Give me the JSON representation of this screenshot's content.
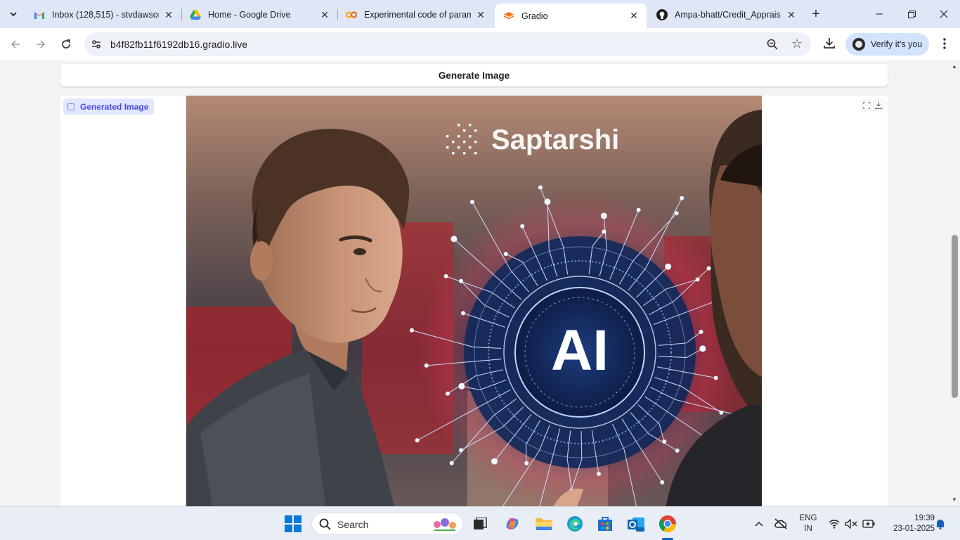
{
  "tabs": [
    {
      "title": "Inbox (128,515) - stvdawson",
      "icon": "gmail-icon"
    },
    {
      "title": "Home - Google Drive",
      "icon": "google-drive-icon"
    },
    {
      "title": "Experimental code of param",
      "icon": "colab-icon"
    },
    {
      "title": "Gradio",
      "icon": "gradio-icon",
      "active": true
    },
    {
      "title": "Ampa-bhatt/Credit_Apprais",
      "icon": "github-icon"
    }
  ],
  "address_bar": {
    "url": "b4f82fb11f6192db16.gradio.live"
  },
  "profile": {
    "label": "Verify it's you"
  },
  "page": {
    "generate_button": "Generate Image",
    "output_label": "Generated Image",
    "image_overlay": {
      "brand": "Saptarshi",
      "center_text": "AI"
    }
  },
  "taskbar": {
    "search_placeholder": "Search",
    "language_line1": "ENG",
    "language_line2": "IN",
    "time": "19:39",
    "date": "23-01-2025"
  },
  "colors": {
    "accent": "#4f46e5",
    "tab_strip": "#dfe6f5",
    "active_tab": "#ffffff"
  }
}
